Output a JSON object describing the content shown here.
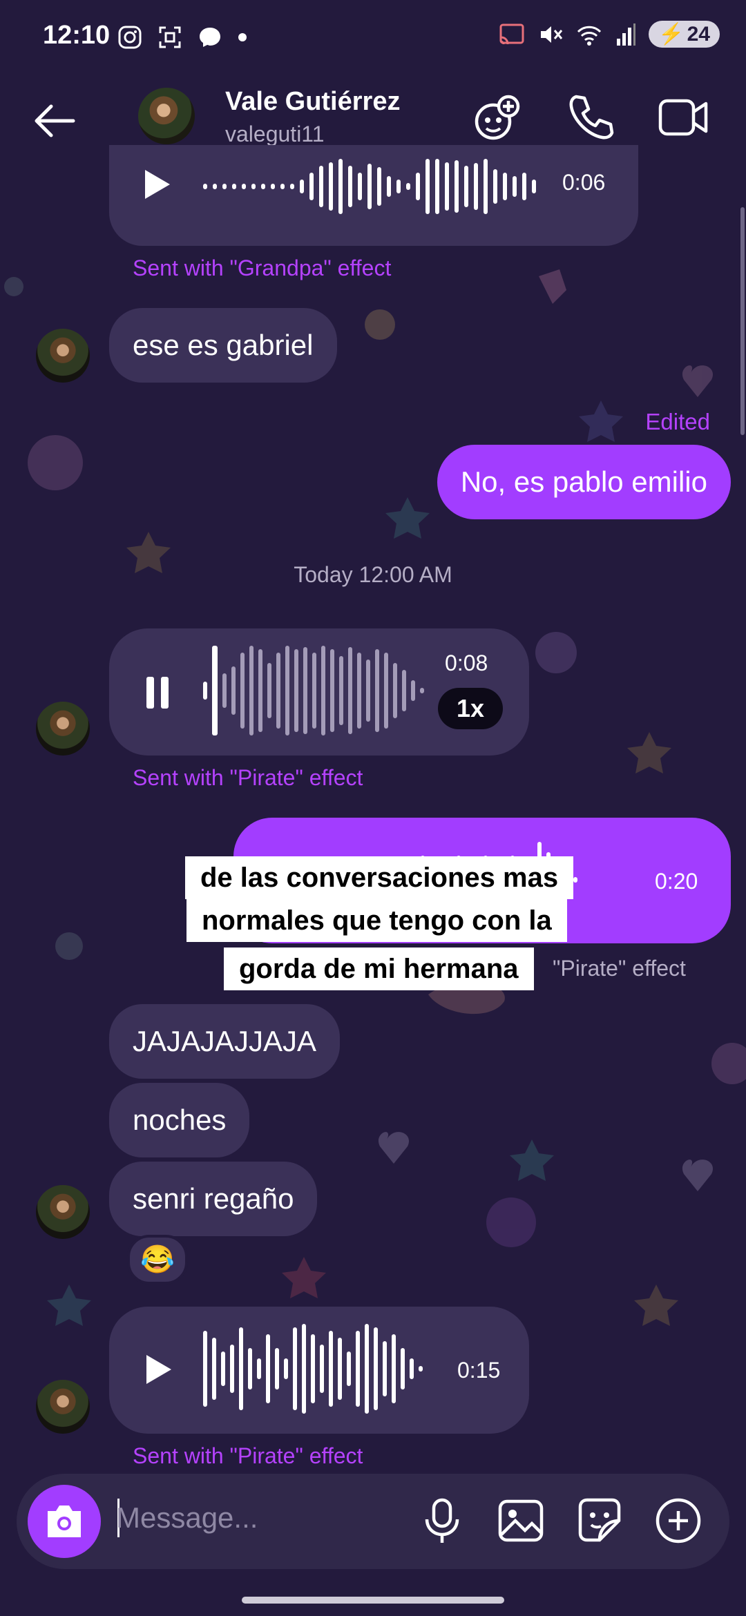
{
  "status_bar": {
    "time": "12:10",
    "battery": "24"
  },
  "header": {
    "name": "Vale Gutiérrez",
    "username": "valeguti11"
  },
  "messages": {
    "voice1": {
      "duration": "0:06",
      "effect": "Sent with \"Grandpa\" effect"
    },
    "text1": "ese es gabriel",
    "edited_label": "Edited",
    "text2": "No, es pablo emilio",
    "timestamp": "Today 12:00 AM",
    "voice2": {
      "duration": "0:08",
      "speed": "1x",
      "effect": "Sent with \"Pirate\" effect"
    },
    "voice3": {
      "duration": "0:20",
      "effect_partial": "\"Pirate\" effect"
    },
    "text3": "JAJAJAJJAJA",
    "text4": "noches",
    "text5": "senri regaño",
    "reaction": "😂",
    "voice4": {
      "duration": "0:15",
      "effect": "Sent with \"Pirate\" effect"
    }
  },
  "caption_overlay": {
    "line1": "de las conversaciones mas",
    "line2": "normales que tengo con la",
    "line3": "gorda de mi hermana"
  },
  "composer": {
    "placeholder": "Message..."
  },
  "colors": {
    "background": "#231a3d",
    "incoming_bubble": "#3b3158",
    "outgoing_bubble": "#a23dff",
    "effect_text": "#b542ff"
  },
  "icons": [
    "back-arrow-icon",
    "add-people-icon",
    "phone-icon",
    "video-icon",
    "camera-icon",
    "microphone-icon",
    "gallery-icon",
    "sticker-icon",
    "plus-icon",
    "play-icon",
    "pause-icon"
  ]
}
